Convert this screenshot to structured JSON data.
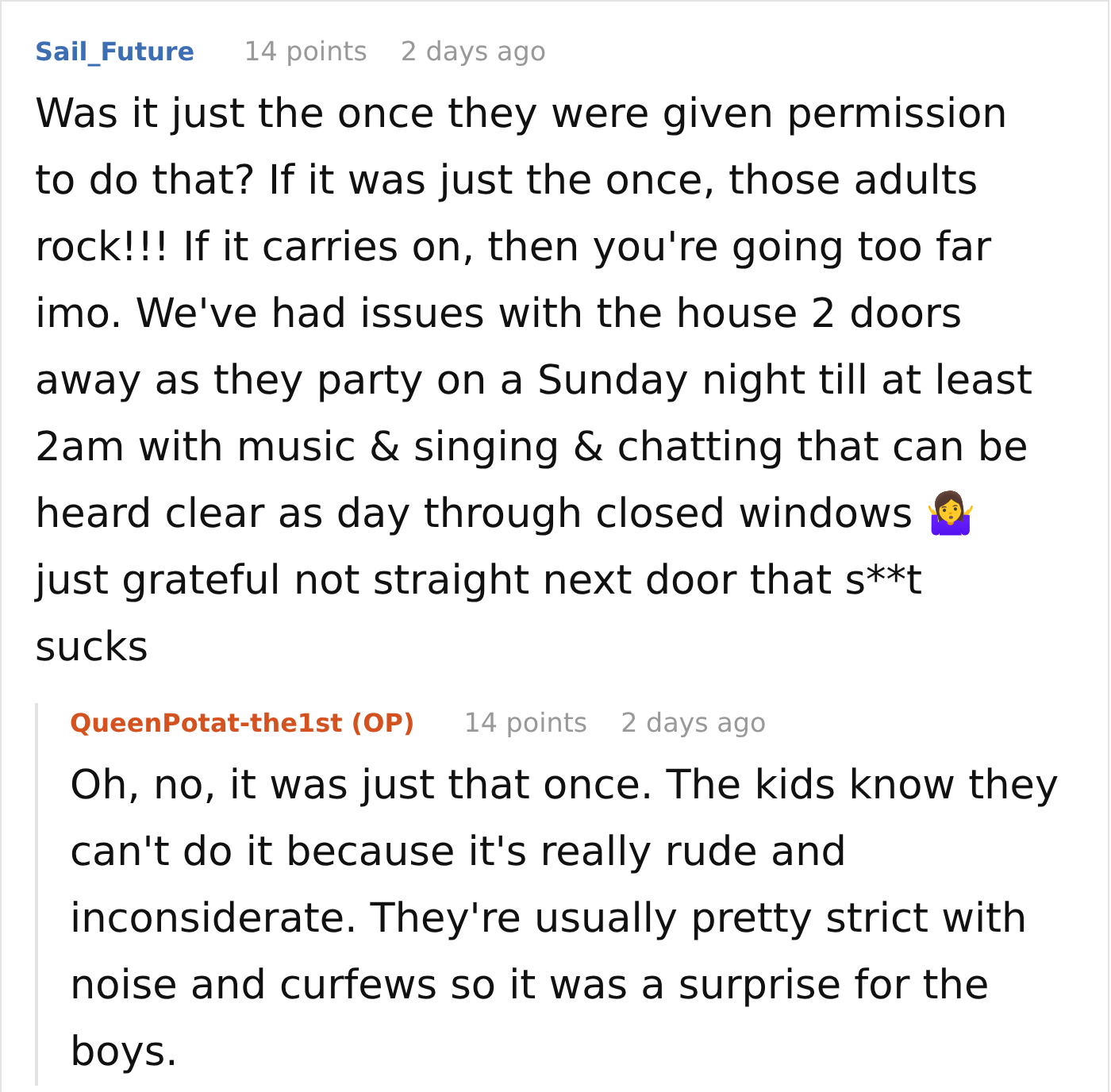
{
  "comments": [
    {
      "author": "Sail_Future",
      "op": false,
      "points": "14 points",
      "time": "2 days ago",
      "body": "Was it just the once they were given permission to do that? If it was just the once, those adults rock!!! If it carries on, then you're going too far imo. We've had issues with the house 2 doors away as they party on a Sunday night till at least 2am with music & singing & chatting that can be heard clear as day through closed windows 🤷‍♀️ just grateful not straight next door that s**t sucks",
      "replies": [
        {
          "author": "QueenPotat-the1st (OP)",
          "op": true,
          "points": "14 points",
          "time": "2 days ago",
          "body": "Oh, no, it was just that once. The kids know they can't do it because it's really rude and inconsiderate. They're usually pretty strict with noise and curfews so it was a surprise for the boys."
        }
      ]
    }
  ]
}
